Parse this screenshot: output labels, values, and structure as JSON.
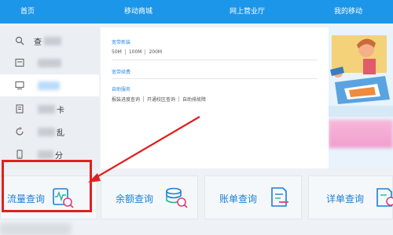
{
  "topnav": {
    "items": [
      {
        "label": "首页"
      },
      {
        "label": "移动商城"
      },
      {
        "label": "网上营业厅"
      },
      {
        "label": "我的移动"
      }
    ]
  },
  "sidebar": {
    "items": [
      {
        "label": "查",
        "icon": "search-icon"
      },
      {
        "label": "",
        "icon": "wallet-icon"
      },
      {
        "label": "",
        "icon": "broadband-icon"
      },
      {
        "label": "卡",
        "icon": "card-icon"
      },
      {
        "label": "乱",
        "icon": "refresh-icon"
      },
      {
        "label": "分",
        "icon": "phone-icon"
      }
    ]
  },
  "panel": {
    "sections": [
      {
        "title": "宽带新装",
        "options": [
          "50M",
          "100M",
          "200M"
        ]
      },
      {
        "title": "宽带续费",
        "options": []
      },
      {
        "title": "自助服务",
        "options": [
          "报装进度查询",
          "开通校区查询",
          "自助排故障"
        ]
      }
    ]
  },
  "tiles": [
    {
      "label": "流量查询",
      "icon": "traffic-query-icon"
    },
    {
      "label": "余额查询",
      "icon": "balance-query-icon"
    },
    {
      "label": "账单查询",
      "icon": "bill-query-icon"
    },
    {
      "label": "详单查询",
      "icon": "detail-query-icon"
    }
  ],
  "colors": {
    "nav_bg": "#1c96e8",
    "tile_text": "#1c7fd6",
    "highlight": "#e02020"
  }
}
